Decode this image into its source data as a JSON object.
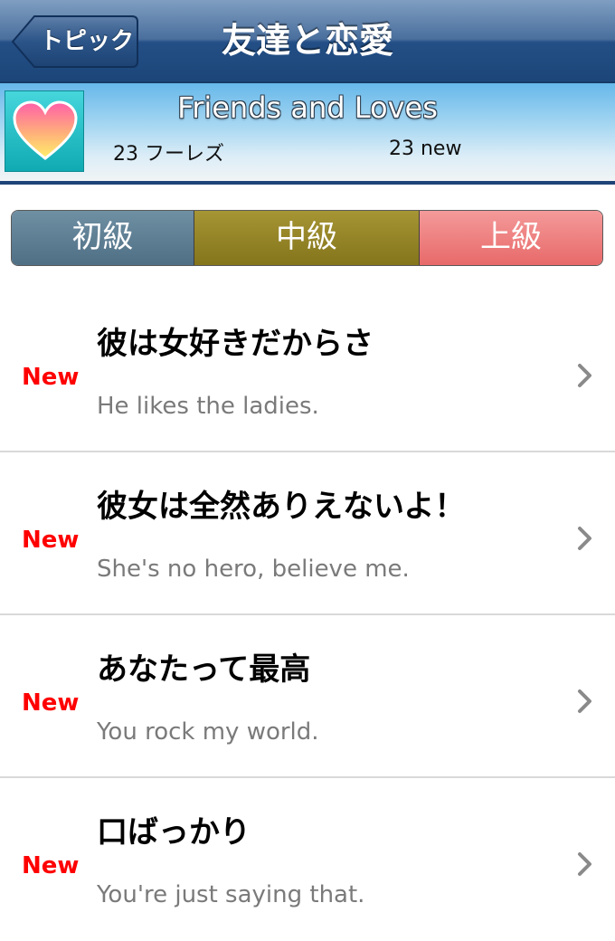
{
  "nav": {
    "back_label": "トピック",
    "title": "友達と恋愛"
  },
  "topic": {
    "title": "Friends and Loves",
    "count": "23 フーレズ",
    "new_count": "23 new",
    "icon": "heart-icon"
  },
  "levels": [
    "初級",
    "中級",
    "上級"
  ],
  "phrases": [
    {
      "badge": "New",
      "japanese": "彼は女好きだからさ",
      "english": "He likes the ladies."
    },
    {
      "badge": "New",
      "japanese": "彼女は全然ありえないよ！",
      "english": "She's no hero, believe me."
    },
    {
      "badge": "New",
      "japanese": "あなたって最高",
      "english": "You rock my world."
    },
    {
      "badge": "New",
      "japanese": "口ばっかり",
      "english": "You're just saying that."
    }
  ],
  "colors": {
    "new_badge": "#ff0000",
    "nav_bar": "#234f86",
    "level_1": "#5a7a90",
    "level_2": "#93842a",
    "level_3": "#ee7a7a"
  }
}
